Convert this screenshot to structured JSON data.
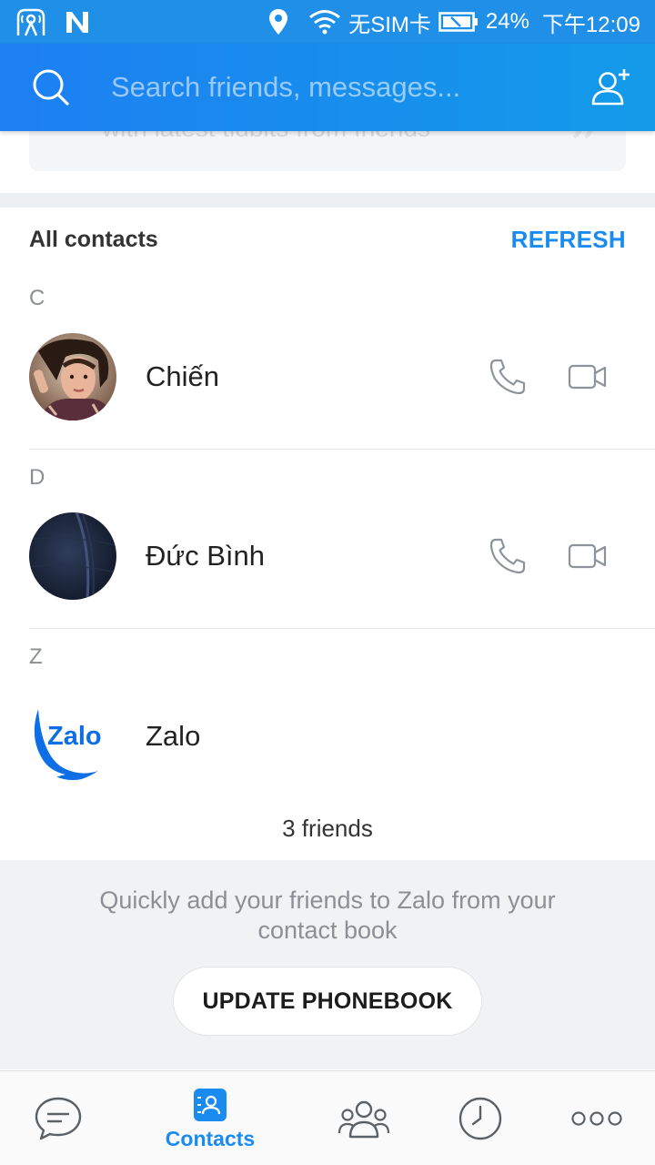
{
  "status_bar": {
    "carrier": "无SIM卡",
    "battery": "24%",
    "time": "下午12:09"
  },
  "search": {
    "placeholder": "Search friends, messages..."
  },
  "story_card": {
    "text": "with latest tidbits from friends",
    "quote": "”"
  },
  "contacts": {
    "title": "All contacts",
    "refresh_label": "REFRESH",
    "sections": [
      {
        "letter": "C",
        "name": "Chiến"
      },
      {
        "letter": "D",
        "name": "Đức Bình"
      },
      {
        "letter": "Z",
        "name": "Zalo"
      }
    ],
    "zalo_logo_text": "Zalo",
    "friends_count": "3 friends"
  },
  "phonebook": {
    "text": "Quickly add your friends to Zalo from your contact book",
    "button_label": "UPDATE PHONEBOOK"
  },
  "bottom_nav": {
    "active_label": "Contacts",
    "active_color": "#1a8cf0"
  },
  "colors": {
    "header_gradient_start": "#1d7ff2",
    "header_gradient_end": "#139be9",
    "accent": "#1a8cf0"
  }
}
